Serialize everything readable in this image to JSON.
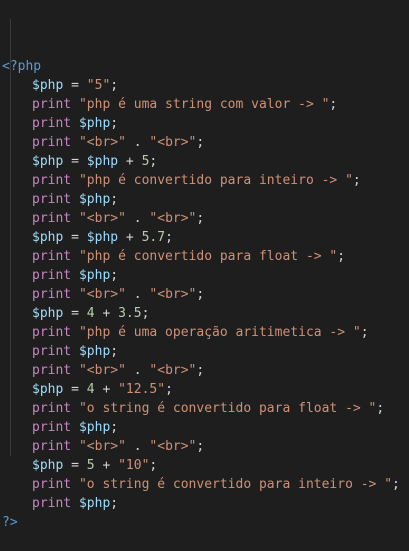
{
  "colors": {
    "background": "#1e1e1e",
    "tag": "#569cd6",
    "variable": "#9cdcfe",
    "keyword": "#c586c0",
    "string": "#ce9178",
    "number": "#b5cea8",
    "operator": "#d4d4d4"
  },
  "lines": [
    {
      "indent": false,
      "tokens": [
        {
          "t": "tag",
          "v": "<?php"
        }
      ]
    },
    {
      "indent": true,
      "tokens": [
        {
          "t": "var",
          "v": "$php"
        },
        {
          "t": "op",
          "v": " = "
        },
        {
          "t": "str",
          "v": "\"5\""
        },
        {
          "t": "op",
          "v": ";"
        }
      ]
    },
    {
      "indent": true,
      "tokens": [
        {
          "t": "kw",
          "v": "print"
        },
        {
          "t": "op",
          "v": " "
        },
        {
          "t": "str",
          "v": "\"php é uma string com valor -> \""
        },
        {
          "t": "op",
          "v": ";"
        }
      ]
    },
    {
      "indent": true,
      "tokens": [
        {
          "t": "kw",
          "v": "print"
        },
        {
          "t": "op",
          "v": " "
        },
        {
          "t": "var",
          "v": "$php"
        },
        {
          "t": "op",
          "v": ";"
        }
      ]
    },
    {
      "indent": true,
      "tokens": [
        {
          "t": "kw",
          "v": "print"
        },
        {
          "t": "op",
          "v": " "
        },
        {
          "t": "str",
          "v": "\"<br>\""
        },
        {
          "t": "op",
          "v": " . "
        },
        {
          "t": "str",
          "v": "\"<br>\""
        },
        {
          "t": "op",
          "v": ";"
        }
      ]
    },
    {
      "indent": true,
      "tokens": [
        {
          "t": "var",
          "v": "$php"
        },
        {
          "t": "op",
          "v": " = "
        },
        {
          "t": "var",
          "v": "$php"
        },
        {
          "t": "op",
          "v": " + "
        },
        {
          "t": "num",
          "v": "5"
        },
        {
          "t": "op",
          "v": ";"
        }
      ]
    },
    {
      "indent": true,
      "tokens": [
        {
          "t": "kw",
          "v": "print"
        },
        {
          "t": "op",
          "v": " "
        },
        {
          "t": "str",
          "v": "\"php é convertido para inteiro -> \""
        },
        {
          "t": "op",
          "v": ";"
        }
      ]
    },
    {
      "indent": true,
      "tokens": [
        {
          "t": "kw",
          "v": "print"
        },
        {
          "t": "op",
          "v": " "
        },
        {
          "t": "var",
          "v": "$php"
        },
        {
          "t": "op",
          "v": ";"
        }
      ]
    },
    {
      "indent": true,
      "tokens": [
        {
          "t": "kw",
          "v": "print"
        },
        {
          "t": "op",
          "v": " "
        },
        {
          "t": "str",
          "v": "\"<br>\""
        },
        {
          "t": "op",
          "v": " . "
        },
        {
          "t": "str",
          "v": "\"<br>\""
        },
        {
          "t": "op",
          "v": ";"
        }
      ]
    },
    {
      "indent": true,
      "tokens": [
        {
          "t": "var",
          "v": "$php"
        },
        {
          "t": "op",
          "v": " = "
        },
        {
          "t": "var",
          "v": "$php"
        },
        {
          "t": "op",
          "v": " + "
        },
        {
          "t": "num",
          "v": "5.7"
        },
        {
          "t": "op",
          "v": ";"
        }
      ]
    },
    {
      "indent": true,
      "tokens": [
        {
          "t": "kw",
          "v": "print"
        },
        {
          "t": "op",
          "v": " "
        },
        {
          "t": "str",
          "v": "\"php é convertido para float -> \""
        },
        {
          "t": "op",
          "v": ";"
        }
      ]
    },
    {
      "indent": true,
      "tokens": [
        {
          "t": "kw",
          "v": "print"
        },
        {
          "t": "op",
          "v": " "
        },
        {
          "t": "var",
          "v": "$php"
        },
        {
          "t": "op",
          "v": ";"
        }
      ]
    },
    {
      "indent": true,
      "tokens": [
        {
          "t": "kw",
          "v": "print"
        },
        {
          "t": "op",
          "v": " "
        },
        {
          "t": "str",
          "v": "\"<br>\""
        },
        {
          "t": "op",
          "v": " . "
        },
        {
          "t": "str",
          "v": "\"<br>\""
        },
        {
          "t": "op",
          "v": ";"
        }
      ]
    },
    {
      "indent": true,
      "tokens": [
        {
          "t": "var",
          "v": "$php"
        },
        {
          "t": "op",
          "v": " = "
        },
        {
          "t": "num",
          "v": "4"
        },
        {
          "t": "op",
          "v": " + "
        },
        {
          "t": "num",
          "v": "3.5"
        },
        {
          "t": "op",
          "v": ";"
        }
      ]
    },
    {
      "indent": true,
      "tokens": [
        {
          "t": "kw",
          "v": "print"
        },
        {
          "t": "op",
          "v": " "
        },
        {
          "t": "str",
          "v": "\"php é uma operação aritimetica -> \""
        },
        {
          "t": "op",
          "v": ";"
        }
      ]
    },
    {
      "indent": true,
      "tokens": [
        {
          "t": "kw",
          "v": "print"
        },
        {
          "t": "op",
          "v": " "
        },
        {
          "t": "var",
          "v": "$php"
        },
        {
          "t": "op",
          "v": ";"
        }
      ]
    },
    {
      "indent": true,
      "tokens": [
        {
          "t": "kw",
          "v": "print"
        },
        {
          "t": "op",
          "v": " "
        },
        {
          "t": "str",
          "v": "\"<br>\""
        },
        {
          "t": "op",
          "v": " . "
        },
        {
          "t": "str",
          "v": "\"<br>\""
        },
        {
          "t": "op",
          "v": ";"
        }
      ]
    },
    {
      "indent": true,
      "tokens": [
        {
          "t": "var",
          "v": "$php"
        },
        {
          "t": "op",
          "v": " = "
        },
        {
          "t": "num",
          "v": "4"
        },
        {
          "t": "op",
          "v": " + "
        },
        {
          "t": "str",
          "v": "\"12.5\""
        },
        {
          "t": "op",
          "v": ";"
        }
      ]
    },
    {
      "indent": true,
      "tokens": [
        {
          "t": "kw",
          "v": "print"
        },
        {
          "t": "op",
          "v": " "
        },
        {
          "t": "str",
          "v": "\"o string é convertido para float -> \""
        },
        {
          "t": "op",
          "v": ";"
        }
      ]
    },
    {
      "indent": true,
      "tokens": [
        {
          "t": "kw",
          "v": "print"
        },
        {
          "t": "op",
          "v": " "
        },
        {
          "t": "var",
          "v": "$php"
        },
        {
          "t": "op",
          "v": ";"
        }
      ]
    },
    {
      "indent": true,
      "tokens": [
        {
          "t": "kw",
          "v": "print"
        },
        {
          "t": "op",
          "v": " "
        },
        {
          "t": "str",
          "v": "\"<br>\""
        },
        {
          "t": "op",
          "v": " . "
        },
        {
          "t": "str",
          "v": "\"<br>\""
        },
        {
          "t": "op",
          "v": ";"
        }
      ]
    },
    {
      "indent": true,
      "tokens": [
        {
          "t": "var",
          "v": "$php"
        },
        {
          "t": "op",
          "v": " = "
        },
        {
          "t": "num",
          "v": "5"
        },
        {
          "t": "op",
          "v": " + "
        },
        {
          "t": "str",
          "v": "\"10\""
        },
        {
          "t": "op",
          "v": ";"
        }
      ]
    },
    {
      "indent": true,
      "tokens": [
        {
          "t": "kw",
          "v": "print"
        },
        {
          "t": "op",
          "v": " "
        },
        {
          "t": "str",
          "v": "\"o string é convertido para inteiro -> \""
        },
        {
          "t": "op",
          "v": ";"
        }
      ]
    },
    {
      "indent": true,
      "tokens": [
        {
          "t": "kw",
          "v": "print"
        },
        {
          "t": "op",
          "v": " "
        },
        {
          "t": "var",
          "v": "$php"
        },
        {
          "t": "op",
          "v": ";"
        }
      ]
    },
    {
      "indent": false,
      "tokens": [
        {
          "t": "tag",
          "v": "?>"
        }
      ]
    }
  ]
}
